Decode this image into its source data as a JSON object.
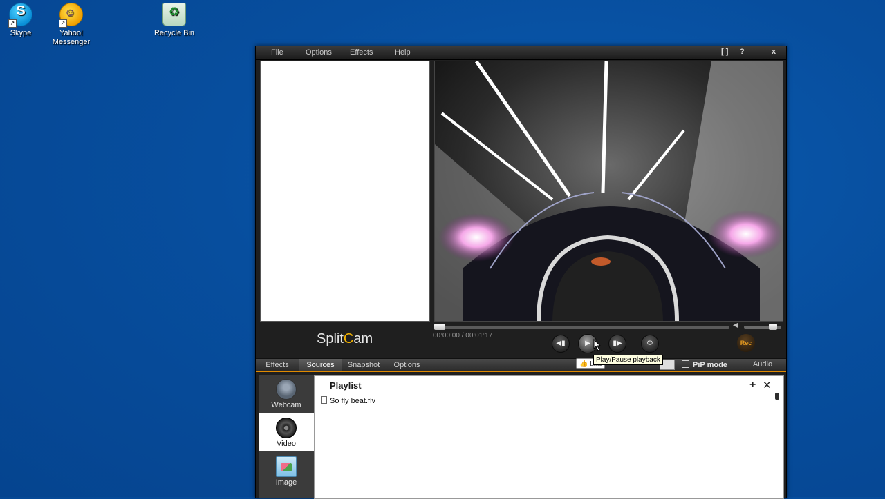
{
  "desktop": {
    "icons": [
      {
        "label": "Skype",
        "icon": "skype-icon"
      },
      {
        "label": "Yahoo!",
        "label2": "Messenger",
        "icon": "yahoo-messenger-icon"
      },
      {
        "label": "Recycle Bin",
        "icon": "recycle-bin-icon"
      }
    ]
  },
  "app": {
    "menu": [
      "File",
      "Options",
      "Effects",
      "Help"
    ],
    "window_controls": [
      "[ ]",
      "?",
      "_",
      "x"
    ],
    "brand_left": "Split",
    "brand_sun": "C",
    "brand_right": "am",
    "time": "00:00:00 / 00:01:17",
    "seek_progress": 0.0,
    "volume_level": 0.85,
    "rec_label": "Rec",
    "tabs": [
      "Effects",
      "Sources",
      "Snapshot",
      "Options"
    ],
    "active_tab": "Sources",
    "like_label": "Like",
    "pip_label": "PiP mode",
    "audio_label": "Audio",
    "tooltip": "Play/Pause playback",
    "sources": [
      {
        "label": "Webcam",
        "icon": "webcam-icon"
      },
      {
        "label": "Video",
        "icon": "video-reel-icon"
      },
      {
        "label": "Image",
        "icon": "image-icon"
      }
    ],
    "active_source": "Video",
    "playlist": {
      "title": "Playlist",
      "add": "+",
      "close": "✕",
      "items": [
        "So fly beat.flv"
      ]
    }
  },
  "colors": {
    "desktop": "#074e9e",
    "accent": "#f5b400",
    "tab_underline": "#e08a00"
  }
}
